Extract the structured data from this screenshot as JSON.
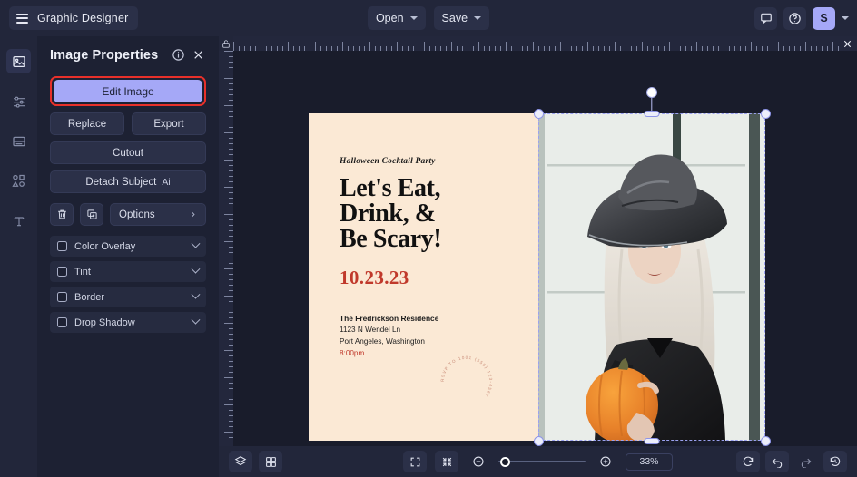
{
  "app": {
    "title": "Graphic Designer",
    "menu_icon": "hamburger-icon"
  },
  "topbar": {
    "open_label": "Open",
    "save_label": "Save",
    "comment_icon": "comment-icon",
    "help_icon": "help-circle-icon",
    "avatar_initial": "S",
    "avatar_caret_icon": "chevron-down-icon"
  },
  "rail": {
    "items": [
      {
        "name": "image-tool",
        "icon": "image-icon",
        "active": true
      },
      {
        "name": "adjust-tool",
        "icon": "sliders-icon",
        "active": false
      },
      {
        "name": "layout-tool",
        "icon": "layout-icon",
        "active": false
      },
      {
        "name": "shapes-tool",
        "icon": "shapes-icon",
        "active": false
      },
      {
        "name": "text-tool",
        "icon": "text-icon",
        "active": false
      }
    ]
  },
  "panel": {
    "title": "Image Properties",
    "info_icon": "info-icon",
    "close_icon": "close-icon",
    "edit_image_label": "Edit Image",
    "replace_label": "Replace",
    "export_label": "Export",
    "cutout_label": "Cutout",
    "detach_subject_label": "Detach Subject",
    "detach_subject_badge": "Ai",
    "delete_icon": "trash-icon",
    "duplicate_icon": "duplicate-icon",
    "options_label": "Options",
    "options_chevron_icon": "chevron-right-icon",
    "effects": [
      {
        "label": "Color Overlay",
        "checked": false
      },
      {
        "label": "Tint",
        "checked": false
      },
      {
        "label": "Border",
        "checked": false
      },
      {
        "label": "Drop Shadow",
        "checked": false
      }
    ],
    "highlight_color": "#e8302a",
    "accent_color": "#a5a8f7"
  },
  "canvas": {
    "lock_icon": "lock-icon",
    "close_icon": "close-icon",
    "background_color": "#fbe9d5",
    "poster": {
      "kicker": "Halloween Cocktail Party",
      "headline_lines": [
        "Let's Eat,",
        "Drink, &",
        "Be Scary!"
      ],
      "date": "10.23.23",
      "venue": "The Fredrickson Residence",
      "address_line": "1123 N Wendel Ln",
      "city_line": "Port Angeles, Washington",
      "time": "8:00pm",
      "stamp_text": "RSVP TO 1001 (555) 123-4567 ",
      "date_color": "#c0392b",
      "stamp_color": "#c98c78"
    },
    "selection": {
      "rotate_handle_icon": "rotate-handle",
      "selected_object": "photo-image"
    }
  },
  "bottombar": {
    "layers_icon": "layers-icon",
    "grid_icon": "grid-icon",
    "fit_icon": "fit-screen-icon",
    "shrink_icon": "shrink-icon",
    "zoom_out_icon": "zoom-out-icon",
    "zoom_in_icon": "zoom-in-icon",
    "zoom_level": "33%",
    "refresh_icon": "refresh-icon",
    "undo_icon": "undo-icon",
    "redo_icon": "redo-icon",
    "history_icon": "history-icon"
  }
}
